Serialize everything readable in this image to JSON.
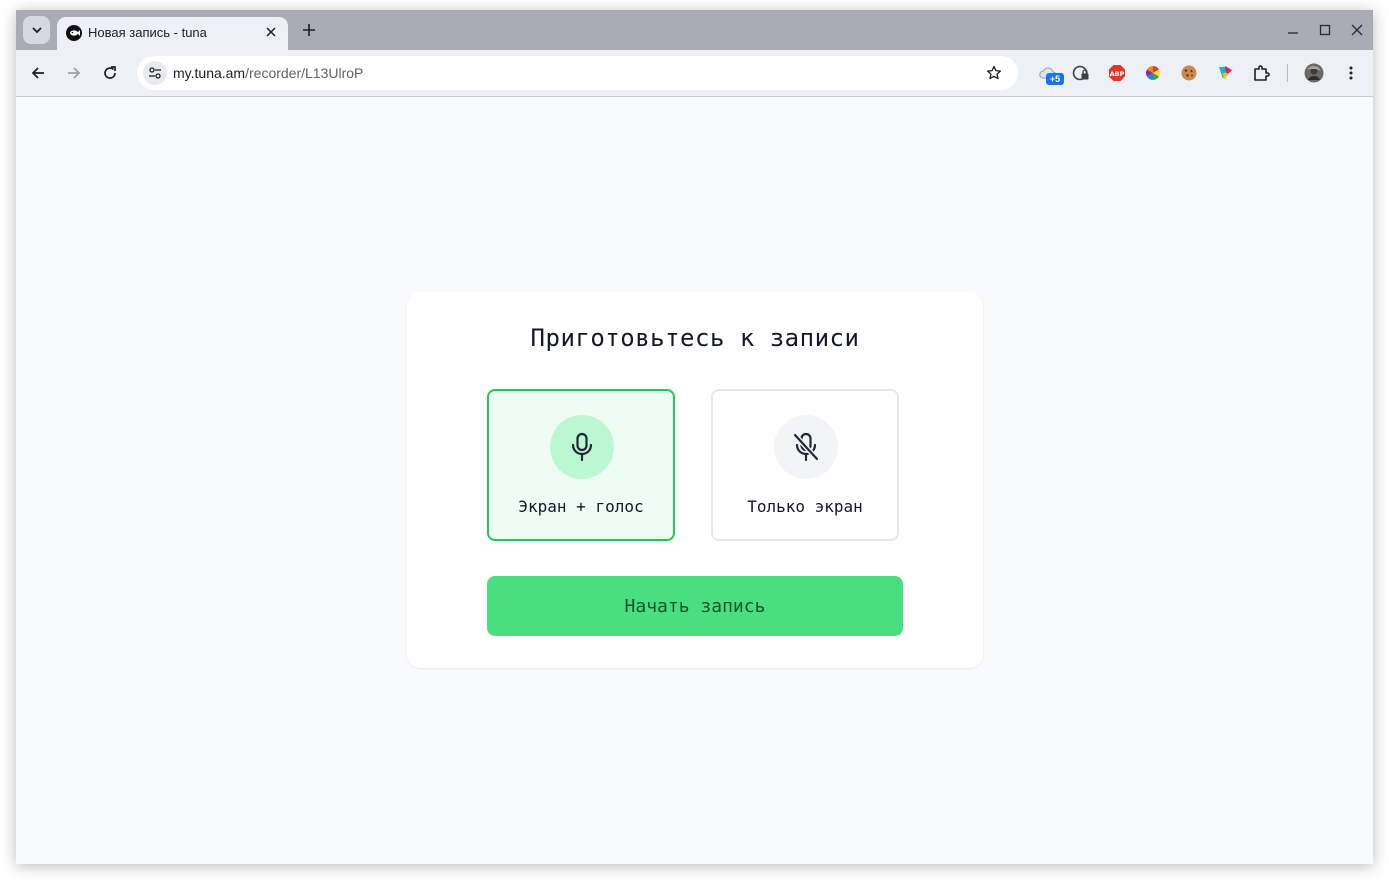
{
  "browser": {
    "tab": {
      "title": "Новая запись - tuna",
      "favicon": "tuna-fish-icon"
    },
    "address_bar": {
      "domain": "my.tuna.am",
      "path": "/recorder/L13UlroP"
    },
    "extensions": [
      {
        "name": "cloud-ext-icon",
        "badge": "+5"
      },
      {
        "name": "lock-ext-icon"
      },
      {
        "name": "abp-ext-icon",
        "text": "ABP"
      },
      {
        "name": "color-wheel-ext-icon"
      },
      {
        "name": "cookie-ext-icon"
      },
      {
        "name": "colorful-ext-icon"
      },
      {
        "name": "puzzle-extensions-icon"
      },
      {
        "name": "profile-avatar"
      }
    ]
  },
  "recorder": {
    "title": "Приготовьтесь к записи",
    "options": [
      {
        "label": "Экран + голос",
        "icon": "microphone-icon",
        "selected": true
      },
      {
        "label": "Только экран",
        "icon": "microphone-off-icon",
        "selected": false
      }
    ],
    "start_label": "Начать запись"
  },
  "colors": {
    "accent_green": "#4ade80",
    "selected_border": "#22c55e",
    "selected_bg": "#effcf3",
    "tab_strip": "#a9abb5",
    "toolbar": "#edf0f5"
  }
}
